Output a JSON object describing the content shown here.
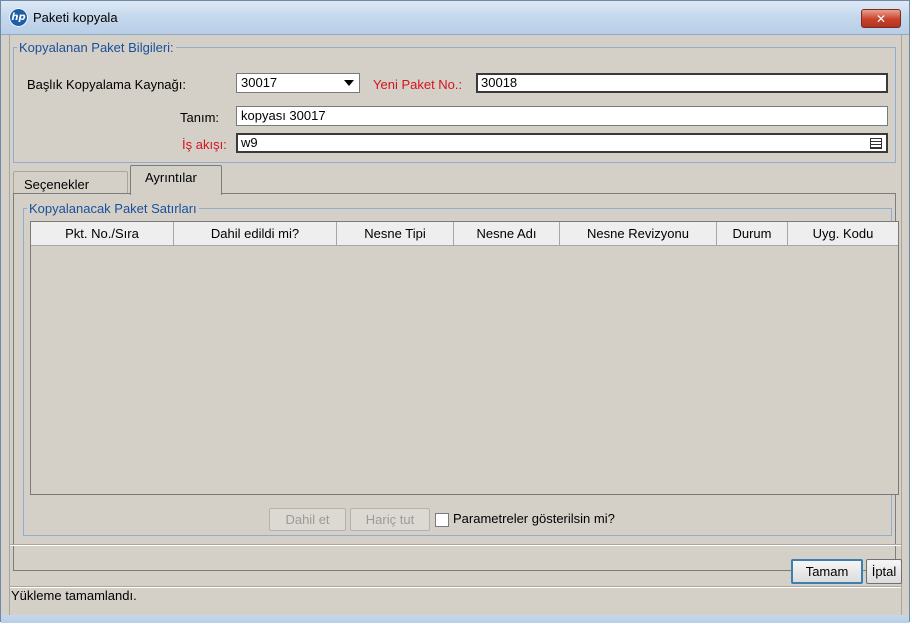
{
  "window": {
    "title": "Paketi kopyala",
    "logo_text": "hp",
    "close_glyph": "✕"
  },
  "info_group": {
    "legend": "Kopyalanan Paket Bilgileri:",
    "source_label": "Başlık Kopyalama Kaynağı:",
    "source_value": "30017",
    "new_no_label": "Yeni Paket No.:",
    "new_no_value": "30018",
    "description_label": "Tanım:",
    "description_value": "kopyası 30017",
    "workflow_label": "İş akışı:",
    "workflow_value": "w9"
  },
  "tabs": [
    {
      "label": "Seçenekler",
      "active": false
    },
    {
      "label": "Ayrıntılar",
      "active": true
    }
  ],
  "lines_group": {
    "legend": "Kopyalanacak Paket Satırları",
    "columns": [
      "Pkt. No./Sıra",
      "Dahil edildi mi?",
      "Nesne Tipi",
      "Nesne Adı",
      "Nesne Revizyonu",
      "Durum",
      "Uyg. Kodu"
    ],
    "rows": []
  },
  "actions": {
    "include_label": "Dahil et",
    "exclude_label": "Hariç tut",
    "show_params_label": "Parametreler gösterilsin mi?",
    "show_params_checked": false
  },
  "footer": {
    "ok_label": "Tamam",
    "cancel_label": "İptal",
    "status_text": "Yükleme tamamlandı."
  },
  "colors": {
    "required_label": "#d4141e",
    "group_legend": "#1a4f9c",
    "dialog_background": "#d4d0c8"
  }
}
